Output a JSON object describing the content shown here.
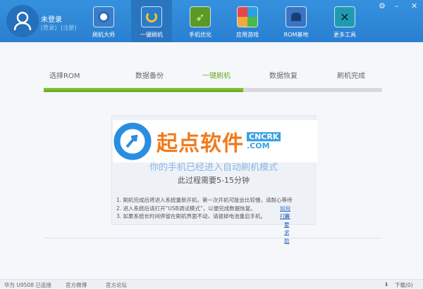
{
  "user": {
    "name": "未登录",
    "login": "[登录]",
    "register": "[注册]"
  },
  "nav": [
    {
      "label": "刷机大师"
    },
    {
      "label": "一键刷机"
    },
    {
      "label": "手机优化"
    },
    {
      "label": "应用游戏"
    },
    {
      "label": "ROM基地"
    },
    {
      "label": "更多工具"
    }
  ],
  "steps": [
    "选择ROM",
    "数据备份",
    "一键刷机",
    "数据恢复",
    "刷机完成"
  ],
  "progress_percent": 59,
  "card": {
    "headline": "你的手机已经进入自动刷机模式",
    "sub": "此过程需要5-15分钟",
    "notes": [
      "1. 刷机完成后将进入系统重新开机，第一次开机可能会比较慢，请耐心等待",
      "2. 进入系统后请打开“USB调试模式”，以便完成数据恢复。",
      "3. 如果系统长时间停留在刷机界面不动，请拔掉电池重启手机。"
    ],
    "link_how": "如何打开",
    "link_help": "我要求助"
  },
  "watermark": {
    "text": "起点软件",
    "tag1": "CNCRK",
    "tag2": ".COM"
  },
  "status": {
    "device": "华为 U9508 已连接",
    "weibo": "官方微博",
    "forum": "官方论坛",
    "download": "下载(0)"
  },
  "colors": {
    "header": "#2f8ad8",
    "progress": "#7dbb30"
  }
}
